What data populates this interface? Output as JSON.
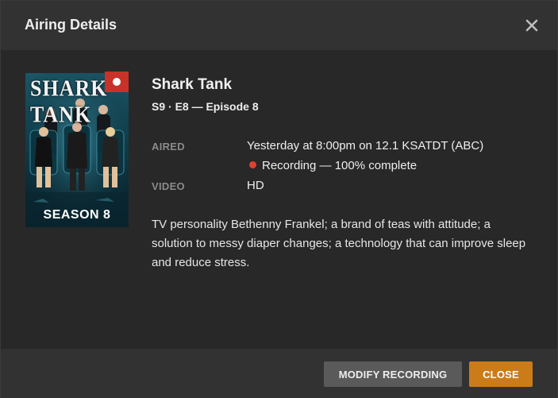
{
  "dialog": {
    "title": "Airing Details"
  },
  "poster": {
    "title_text": "SHARK TANK",
    "season_text": "SEASON 8"
  },
  "show": {
    "title": "Shark Tank",
    "episode_line": "S9 · E8 — Episode 8"
  },
  "details": {
    "aired_label": "AIRED",
    "aired_value": "Yesterday at 8:00pm on 12.1 KSATDT (ABC)",
    "recording_status": "Recording — 100% complete",
    "video_label": "VIDEO",
    "video_value": "HD"
  },
  "summary": "TV personality Bethenny Frankel; a brand of teas with attitude; a solution to messy diaper changes; a technology that can improve sleep and reduce stress.",
  "footer": {
    "modify_label": "MODIFY RECORDING",
    "close_label": "CLOSE"
  },
  "colors": {
    "accent": "#cc7b19",
    "recording": "#e0412f",
    "badge": "#c83228",
    "secondary_button": "#5a5a5a"
  },
  "icons": {
    "close": "close-icon",
    "recording_badge": "record-dot-icon",
    "recording_dot": "record-dot-icon"
  }
}
